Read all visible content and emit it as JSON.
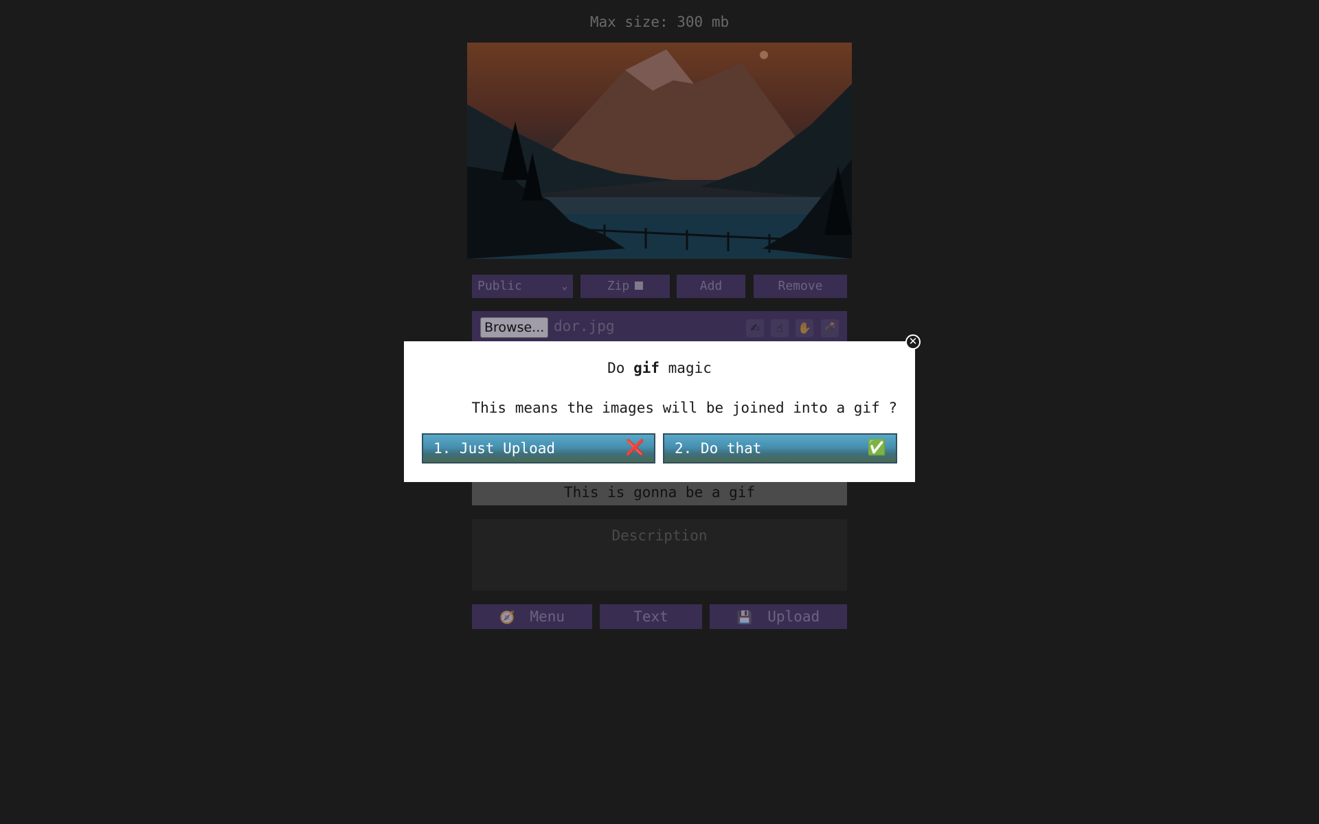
{
  "header": {
    "max_size": "Max size: 300 mb"
  },
  "controls": {
    "visibility_selected": "Public",
    "zip_label": "Zip",
    "add_label": "Add",
    "remove_label": "Remove"
  },
  "file": {
    "browse_label": "Browse...",
    "file_name": "dor.jpg",
    "tools": [
      "✍",
      "☝",
      "✋",
      "💣"
    ]
  },
  "gif_notice": "This is gonna be a gif",
  "description": {
    "placeholder": "Description"
  },
  "bottom": {
    "menu_icon": "🧭",
    "menu_label": "Menu",
    "text_label": "Text",
    "upload_icon": "💾",
    "upload_label": "Upload"
  },
  "modal": {
    "title_prefix": "Do",
    "title_bold": "gif",
    "title_suffix": "magic",
    "message": "This means the images will be joined into a gif ?",
    "option1_label": "1. Just Upload",
    "option1_mark": "❌",
    "option2_label": "2. Do that",
    "option2_mark": "✅",
    "close_symbol": "✕"
  },
  "colors": {
    "background": "#1b1b1b",
    "dim_button": "#3a2d52",
    "modal_button": "#4690b0"
  }
}
